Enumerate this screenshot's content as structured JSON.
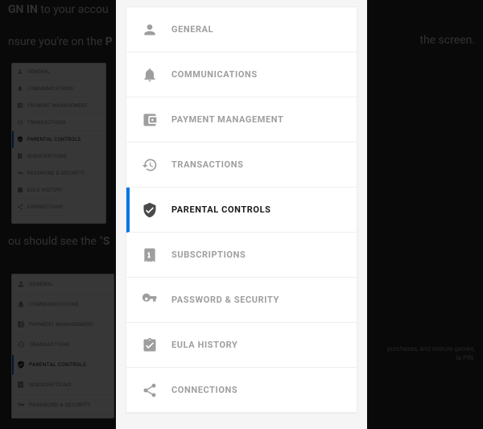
{
  "background": {
    "line1_prefix_bold": "GN IN",
    "line1_rest": " to your accou",
    "line2_prefix": "nsure you're on the ",
    "line2_bold": "P",
    "line2_tail": "the screen.",
    "line3_prefix": "ou should see the \"",
    "line3_bold": "S",
    "small_note_1": "purchases, and mature games,",
    "small_note_2": "ia PIN."
  },
  "mini_menu": {
    "items": [
      {
        "label": "GENERAL"
      },
      {
        "label": "COMMUNICATIONS"
      },
      {
        "label": "PAYMENT MANAGEMENT"
      },
      {
        "label": "TRANSACTIONS"
      },
      {
        "label": "PARENTAL CONTROLS",
        "active": true
      },
      {
        "label": "SUBSCRIPTIONS"
      },
      {
        "label": "PASSWORD & SECURITY"
      },
      {
        "label": "EULA HISTORY"
      },
      {
        "label": "CONNECTIONS"
      }
    ]
  },
  "mini_menu_b": {
    "items": [
      {
        "label": "GENERAL"
      },
      {
        "label": "COMMUNICATIONS"
      },
      {
        "label": "PAYMENT MANAGEMENT"
      },
      {
        "label": "TRANSACTIONS"
      },
      {
        "label": "PARENTAL CONTROLS",
        "active": true
      },
      {
        "label": "SUBSCRIPTIONS"
      },
      {
        "label": "PASSWORD & SECURITY"
      }
    ]
  },
  "menu": {
    "items": [
      {
        "label": "GENERAL",
        "icon": "person-icon"
      },
      {
        "label": "COMMUNICATIONS",
        "icon": "bell-icon"
      },
      {
        "label": "PAYMENT MANAGEMENT",
        "icon": "wallet-icon"
      },
      {
        "label": "TRANSACTIONS",
        "icon": "history-icon"
      },
      {
        "label": "PARENTAL CONTROLS",
        "icon": "shield-check-icon",
        "active": true
      },
      {
        "label": "SUBSCRIPTIONS",
        "icon": "receipt-icon"
      },
      {
        "label": "PASSWORD & SECURITY",
        "icon": "key-icon"
      },
      {
        "label": "EULA HISTORY",
        "icon": "clipboard-icon"
      },
      {
        "label": "CONNECTIONS",
        "icon": "share-icon"
      }
    ]
  },
  "colors": {
    "accent": "#0074e4"
  }
}
